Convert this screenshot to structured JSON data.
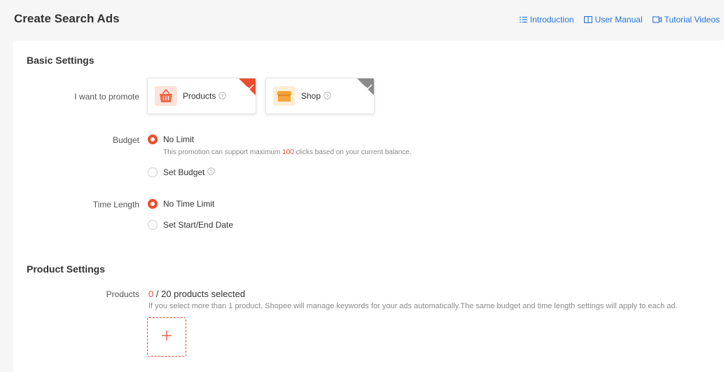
{
  "header": {
    "title": "Create Search Ads",
    "links": [
      {
        "label": "Introduction",
        "icon": "list-icon"
      },
      {
        "label": "User Manual",
        "icon": "book-icon"
      },
      {
        "label": "Tutorial Videos",
        "icon": "video-icon"
      }
    ]
  },
  "basic": {
    "title": "Basic Settings",
    "promote_label": "I want to promote",
    "options": [
      {
        "label": "Products",
        "selected": true
      },
      {
        "label": "Shop",
        "selected": false
      }
    ],
    "budget_label": "Budget",
    "budget_options": [
      "No Limit",
      "Set Budget"
    ],
    "budget_hint_pre": "This promotion can support maximum",
    "budget_hint_num": "100",
    "budget_hint_post": "clicks based on your current balance.",
    "time_label": "Time Length",
    "time_options": [
      "No Time Limit",
      "Set Start/End Date"
    ]
  },
  "product": {
    "title": "Product Settings",
    "label": "Products",
    "selected_count": "0",
    "total_text": "/ 20 products selected",
    "hint": "If you select more than 1 product, Shopee will manage keywords for your ads automatically.The same budget and time length settings will apply to each ad."
  },
  "colors": {
    "accent": "#ee4d2d",
    "link": "#2673dd"
  }
}
